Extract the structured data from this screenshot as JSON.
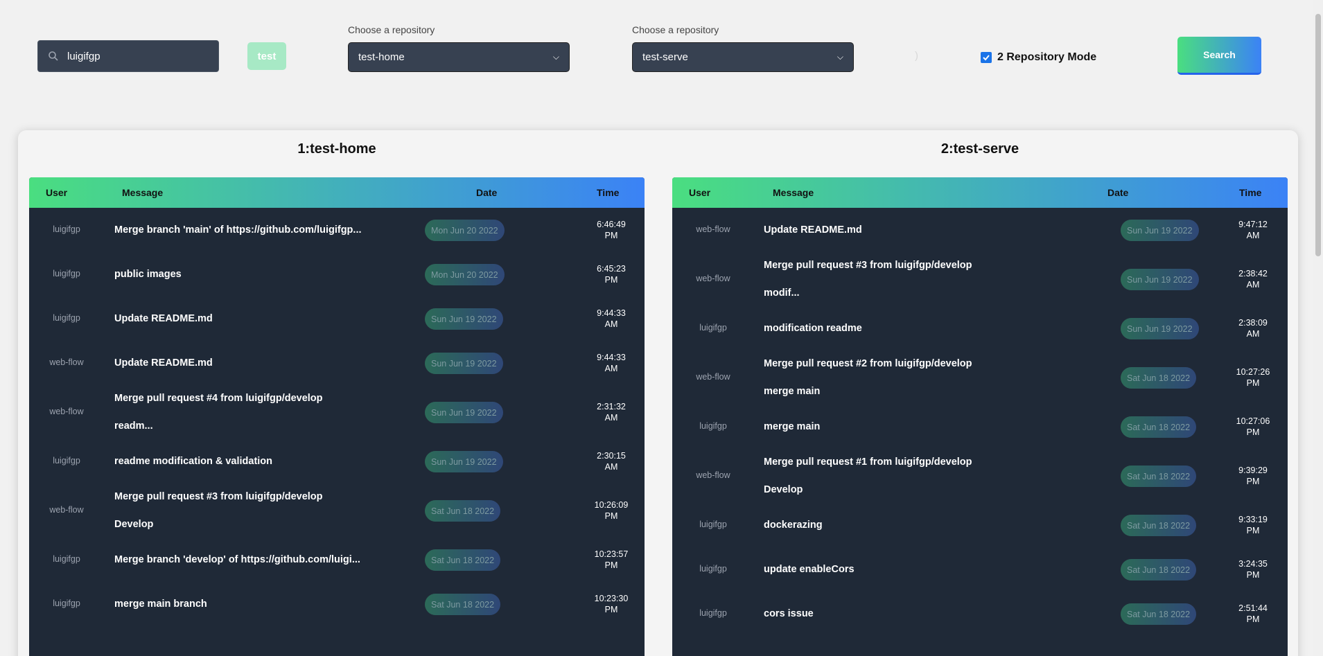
{
  "search": {
    "value": "luigifgp"
  },
  "user_chip": "test",
  "selectors": [
    {
      "label": "Choose a repository",
      "value": "test-home"
    },
    {
      "label": "Choose a repository",
      "value": "test-serve"
    }
  ],
  "paren_text": ")",
  "mode": {
    "label": "2 Repository Mode",
    "checked": true
  },
  "search_button": "Search",
  "headers": {
    "user": "User",
    "message": "Message",
    "date": "Date",
    "time": "Time"
  },
  "repos": [
    {
      "title": "1:test-home",
      "rows": [
        {
          "user": "luigifgp",
          "message": [
            "Merge branch 'main' of https://github.com/luigifgp..."
          ],
          "date": "Mon Jun 20 2022",
          "time": [
            "6:46:49",
            "PM"
          ]
        },
        {
          "user": "luigifgp",
          "message": [
            "public images"
          ],
          "date": "Mon Jun 20 2022",
          "time": [
            "6:45:23",
            "PM"
          ]
        },
        {
          "user": "luigifgp",
          "message": [
            "Update README.md"
          ],
          "date": "Sun Jun 19 2022",
          "time": [
            "9:44:33",
            "AM"
          ]
        },
        {
          "user": "web-flow",
          "message": [
            "Update README.md"
          ],
          "date": "Sun Jun 19 2022",
          "time": [
            "9:44:33",
            "AM"
          ]
        },
        {
          "user": "web-flow",
          "message": [
            "Merge pull request #4 from luigifgp/develop",
            "readm..."
          ],
          "date": "Sun Jun 19 2022",
          "time": [
            "2:31:32",
            "AM"
          ]
        },
        {
          "user": "luigifgp",
          "message": [
            "readme modification & validation"
          ],
          "date": "Sun Jun 19 2022",
          "time": [
            "2:30:15",
            "AM"
          ]
        },
        {
          "user": "web-flow",
          "message": [
            "Merge pull request #3 from luigifgp/develop",
            "Develop"
          ],
          "date": "Sat Jun 18 2022",
          "time": [
            "10:26:09",
            "PM"
          ]
        },
        {
          "user": "luigifgp",
          "message": [
            "Merge branch 'develop' of https://github.com/luigi..."
          ],
          "date": "Sat Jun 18 2022",
          "time": [
            "10:23:57",
            "PM"
          ]
        },
        {
          "user": "luigifgp",
          "message": [
            "merge main branch"
          ],
          "date": "Sat Jun 18 2022",
          "time": [
            "10:23:30",
            "PM"
          ]
        }
      ]
    },
    {
      "title": "2:test-serve",
      "rows": [
        {
          "user": "web-flow",
          "message": [
            "Update README.md"
          ],
          "date": "Sun Jun 19 2022",
          "time": [
            "9:47:12",
            "AM"
          ]
        },
        {
          "user": "web-flow",
          "message": [
            "Merge pull request #3 from luigifgp/develop",
            "modif..."
          ],
          "date": "Sun Jun 19 2022",
          "time": [
            "2:38:42",
            "AM"
          ]
        },
        {
          "user": "luigifgp",
          "message": [
            "modification readme"
          ],
          "date": "Sun Jun 19 2022",
          "time": [
            "2:38:09",
            "AM"
          ]
        },
        {
          "user": "web-flow",
          "message": [
            "Merge pull request #2 from luigifgp/develop",
            "merge main"
          ],
          "date": "Sat Jun 18 2022",
          "time": [
            "10:27:26",
            "PM"
          ]
        },
        {
          "user": "luigifgp",
          "message": [
            "merge main"
          ],
          "date": "Sat Jun 18 2022",
          "time": [
            "10:27:06",
            "PM"
          ]
        },
        {
          "user": "web-flow",
          "message": [
            "Merge pull request #1 from luigifgp/develop",
            "Develop"
          ],
          "date": "Sat Jun 18 2022",
          "time": [
            "9:39:29",
            "PM"
          ]
        },
        {
          "user": "luigifgp",
          "message": [
            "dockerazing"
          ],
          "date": "Sat Jun 18 2022",
          "time": [
            "9:33:19",
            "PM"
          ]
        },
        {
          "user": "luigifgp",
          "message": [
            "update enableCors"
          ],
          "date": "Sat Jun 18 2022",
          "time": [
            "3:24:35",
            "PM"
          ]
        },
        {
          "user": "luigifgp",
          "message": [
            "cors issue"
          ],
          "date": "Sat Jun 18 2022",
          "time": [
            "2:51:44",
            "PM"
          ]
        }
      ]
    }
  ],
  "colors": {
    "accent_start": "#4ade80",
    "accent_end": "#3b82f6",
    "table_bg": "#1f2937",
    "input_bg": "#374151"
  }
}
